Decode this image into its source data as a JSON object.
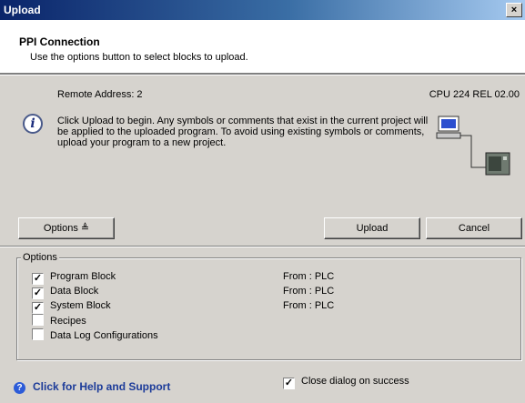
{
  "window": {
    "title": "Upload",
    "close_glyph": "×"
  },
  "header": {
    "title": "PPI Connection",
    "subtitle": "Use the options button to select blocks to upload."
  },
  "status": {
    "remote_address": "Remote Address: 2",
    "cpu": "CPU 224 REL 02.00"
  },
  "info": {
    "icon": "info-icon",
    "text": "Click Upload to begin. Any symbols or comments that exist in the current project will be applied to the uploaded program.  To avoid using existing symbols or comments, upload your program to a new project."
  },
  "buttons": {
    "options_label": "Options ≜",
    "upload_label": "Upload",
    "cancel_label": "Cancel"
  },
  "options": {
    "group_label": "Options",
    "items": [
      {
        "label": "Program Block",
        "checked": true,
        "from": "From : PLC"
      },
      {
        "label": "Data Block",
        "checked": true,
        "from": "From : PLC"
      },
      {
        "label": "System Block",
        "checked": true,
        "from": "From : PLC"
      },
      {
        "label": "Recipes",
        "checked": false,
        "from": ""
      },
      {
        "label": "Data Log Configurations",
        "checked": false,
        "from": ""
      }
    ]
  },
  "footer": {
    "help_label": "Click for Help and Support",
    "close_on_success_label": "Close dialog on success",
    "close_on_success_checked": true
  }
}
